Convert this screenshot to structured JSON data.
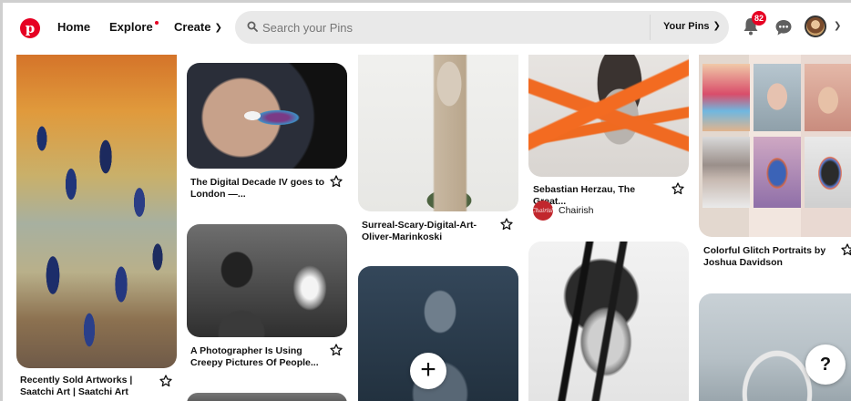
{
  "header": {
    "logo_letter": "p",
    "nav": {
      "home": "Home",
      "explore": "Explore",
      "create": "Create"
    },
    "search": {
      "placeholder": "Search your Pins",
      "scope": "Your Pins"
    },
    "notifications_count": "82"
  },
  "pins": [
    {
      "title": "Recently Sold Artworks | Saatchi Art | Saatchi Art"
    },
    {
      "title": "The Digital Decade IV goes to London —..."
    },
    {
      "title": "Surreal-Scary-Digital-Art-Oliver-Marinkoski"
    },
    {
      "title": "Sebastian Herzau, The Great...",
      "source": "Chairish",
      "source_logo_text": "Chairish"
    },
    {
      "title": "Colorful Glitch Portraits by Joshua Davidson"
    },
    {
      "title": "A Photographer Is Using Creepy Pictures Of People..."
    }
  ],
  "buttons": {
    "add": "+",
    "help": "?"
  },
  "colors": {
    "brand": "#e60023",
    "search_bg": "#e9e9e9"
  }
}
